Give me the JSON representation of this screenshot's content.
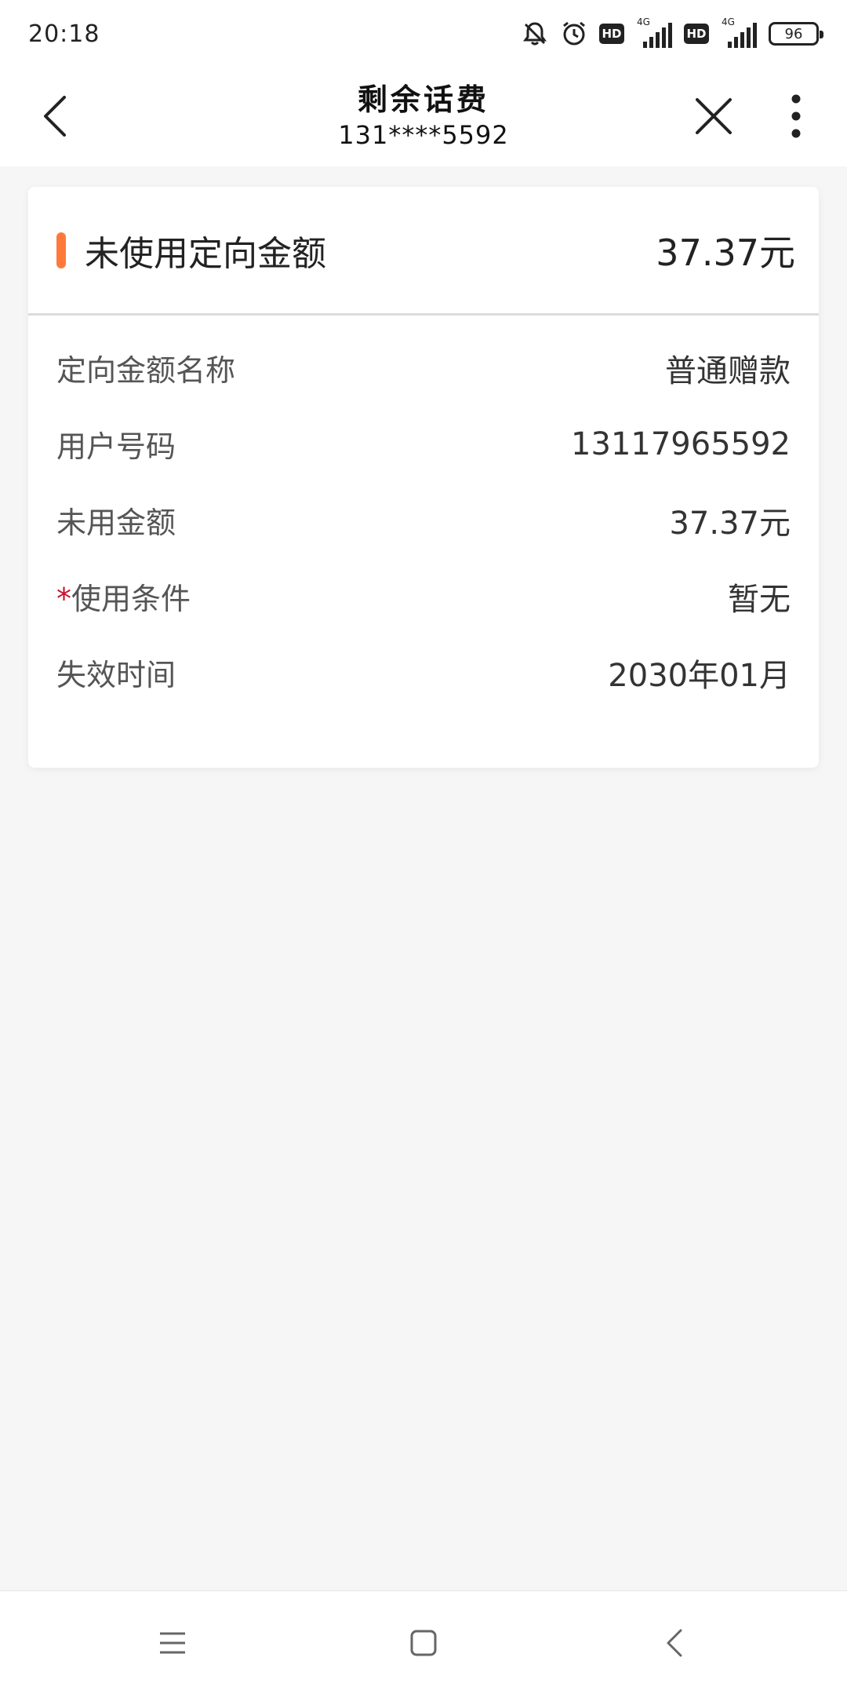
{
  "status_bar": {
    "time": "20:18",
    "icons": [
      "mute-bell-icon",
      "alarm-icon",
      "hd-icon",
      "signal-4g-icon",
      "hd-icon",
      "signal-4g-icon",
      "battery-icon"
    ],
    "hd_label": "HD",
    "network_label": "4G",
    "battery_level": "96"
  },
  "nav": {
    "title": "剩余话费",
    "subtitle": "131****5592"
  },
  "card": {
    "title": "未使用定向金额",
    "amount": "37.37元",
    "accent_color": "#ff7a3a",
    "rows": [
      {
        "label": "定向金额名称",
        "value": "普通赠款"
      },
      {
        "label": "用户号码",
        "value": "13117965592"
      },
      {
        "label": "未用金额",
        "value": "37.37元"
      },
      {
        "label": "使用条件",
        "value": "暂无",
        "required_mark": "*"
      },
      {
        "label": "失效时间",
        "value": "2030年01月"
      }
    ]
  },
  "bottom_nav": {
    "icons": [
      "menu-icon",
      "home-icon",
      "back-icon"
    ]
  }
}
